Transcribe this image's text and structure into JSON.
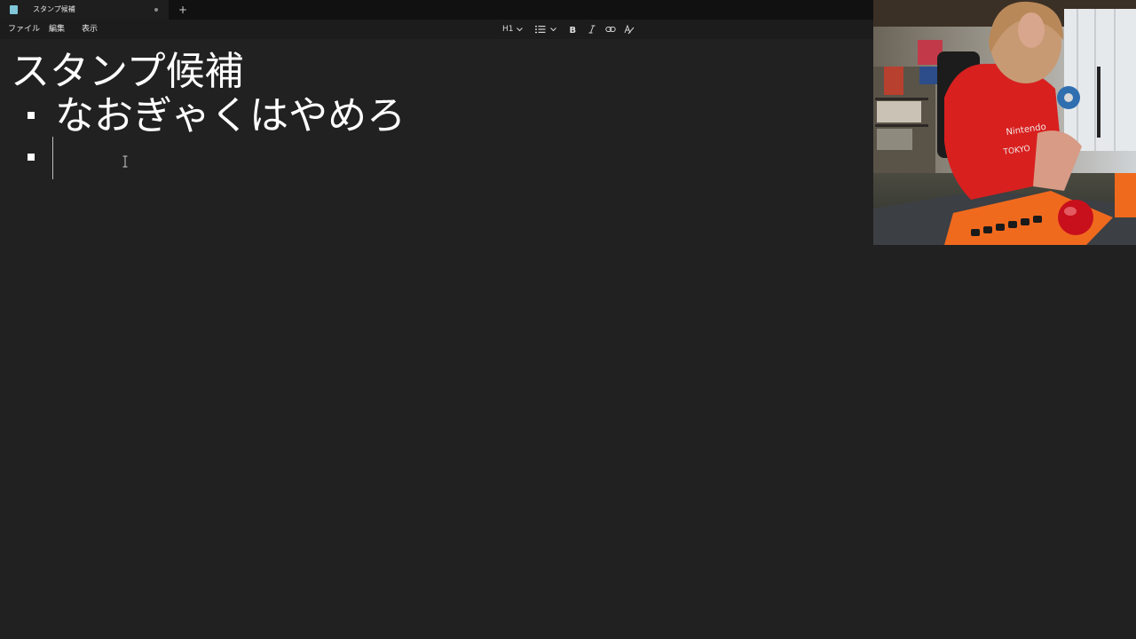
{
  "window": {
    "tab_title": "スタンプ候補",
    "new_tab_symbol": "+"
  },
  "menu": {
    "file": "ファイル",
    "edit": "編集",
    "view": "表示"
  },
  "toolbar": {
    "heading_level": "H1"
  },
  "document": {
    "heading": "スタンプ候補",
    "bullets": [
      {
        "text": "なおぎゃくはやめろ"
      },
      {
        "text": ""
      }
    ]
  },
  "webcam": {
    "shirt_text_1": "Nintendo",
    "shirt_text_2": "TOKYO"
  },
  "colors": {
    "background": "#212121",
    "titlebar": "#111111",
    "text": "#ffffff",
    "shirt": "#e0201e",
    "keyboard": "#f06a1e"
  }
}
